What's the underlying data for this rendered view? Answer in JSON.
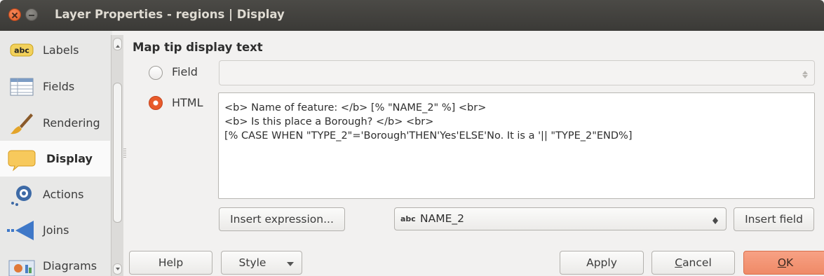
{
  "window": {
    "title": "Layer Properties - regions | Display"
  },
  "sidebar": {
    "items": [
      {
        "label": "Labels",
        "icon": "labels-abc-icon"
      },
      {
        "label": "Fields",
        "icon": "fields-table-icon"
      },
      {
        "label": "Rendering",
        "icon": "rendering-brush-icon"
      },
      {
        "label": "Display",
        "icon": "display-speech-bubble-icon",
        "active": true
      },
      {
        "label": "Actions",
        "icon": "actions-gear-icon"
      },
      {
        "label": "Joins",
        "icon": "joins-arrow-icon"
      },
      {
        "label": "Diagrams",
        "icon": "diagrams-icon"
      }
    ]
  },
  "main": {
    "section_title": "Map tip display text",
    "field_option": {
      "label": "Field",
      "selected": false,
      "value": ""
    },
    "html_option": {
      "label": "HTML",
      "selected": true
    },
    "html_lines": [
      "<b> Name of feature: </b> [% \"NAME_2\" %] <br>",
      "<b> Is this place a Borough? </b> <br>",
      "[% CASE WHEN \"TYPE_2\"='Borough'THEN'Yes'ELSE'No. It is a '|| \"TYPE_2\"END%]"
    ],
    "insert_expression_label": "Insert expression...",
    "field_select": {
      "type_badge": "abc",
      "value": "NAME_2"
    },
    "insert_field_label": "Insert field"
  },
  "footer": {
    "help_label": "Help",
    "style_label": "Style",
    "apply_label": "Apply",
    "cancel_prefix": "",
    "cancel_mnemonic": "C",
    "cancel_rest": "ancel",
    "ok_mnemonic": "O",
    "ok_rest": "K"
  },
  "colors": {
    "titlebar": "#3b3a37",
    "accent": "#e85a2a",
    "ok_button": "#ef8a67"
  }
}
